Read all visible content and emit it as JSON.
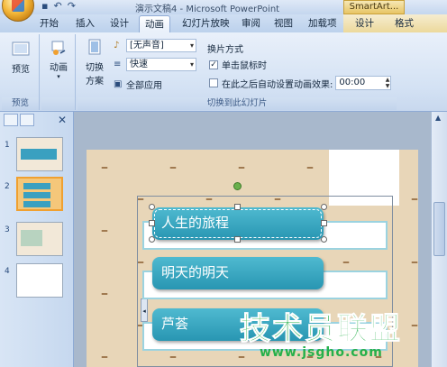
{
  "window": {
    "title": "演示文稿4 - Microsoft PowerPoint",
    "context_tab_header": "SmartArt..."
  },
  "ribbon_tabs": [
    "开始",
    "插入",
    "设计",
    "动画",
    "幻灯片放映",
    "审阅",
    "视图",
    "加载项",
    "设计",
    "格式"
  ],
  "active_tab": "动画",
  "groups": {
    "preview": {
      "button": "预览",
      "label": "预览"
    },
    "animations": {
      "button": "动画"
    },
    "transition": {
      "scheme_button_line1": "切换",
      "scheme_button_line2": "方案",
      "sound_value": "[无声音]",
      "speed_value": "快速",
      "apply_all": "全部应用",
      "advance_header": "换片方式",
      "on_click_label": "单击鼠标时",
      "on_click_checked": "✓",
      "auto_label": "在此之后自动设置动画效果:",
      "auto_time": "00:00",
      "label": "切换到此幻灯片"
    }
  },
  "slides_panel": {
    "slide_numbers": [
      "1",
      "2",
      "3",
      "4"
    ],
    "selected": "2"
  },
  "slide": {
    "items": [
      "人生的旅程",
      "明天的明天",
      "芦荟"
    ]
  },
  "watermark": {
    "text": "技术员联盟",
    "url": "www.jsgho.com"
  },
  "colors": {
    "smartart_fill": "#2896b2",
    "selected_thumb_border": "#f0a030",
    "watermark": "#25b04a"
  }
}
